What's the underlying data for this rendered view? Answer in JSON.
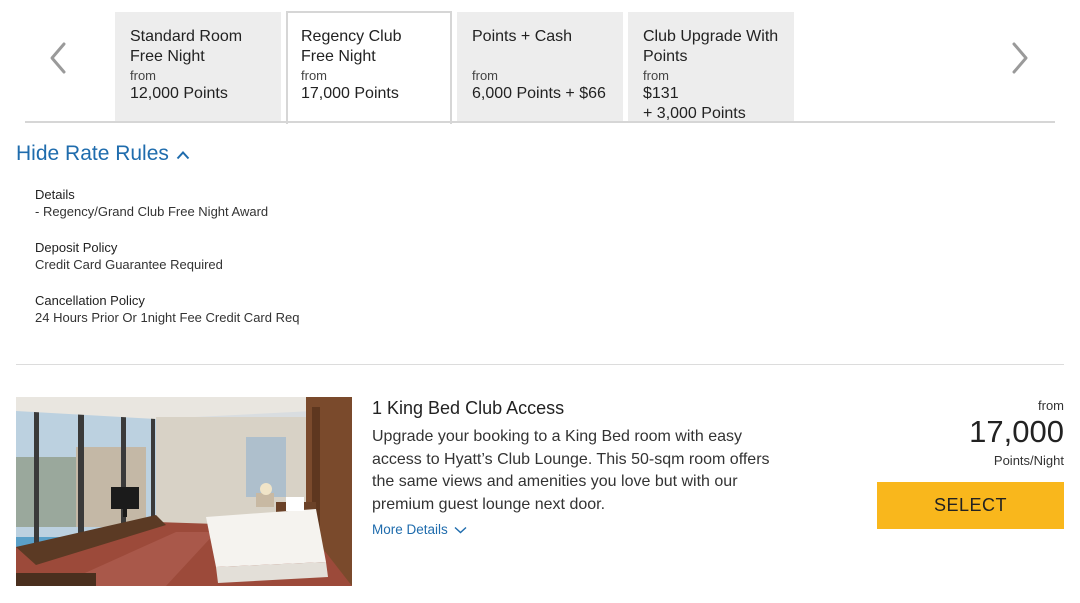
{
  "rate_tabs": [
    {
      "title": "Standard Room Free Night",
      "from": "from",
      "price": "12,000 Points"
    },
    {
      "title": "Regency Club Free Night",
      "from": "from",
      "price": "17,000 Points"
    },
    {
      "title": "Points + Cash",
      "from": "from",
      "price": "6,000 Points + $66"
    },
    {
      "title": "Club Upgrade With Points",
      "from": "from",
      "price": "$131\n+ 3,000 Points"
    }
  ],
  "active_tab_index": 1,
  "icons": {
    "prev": "chevron-left-icon",
    "next": "chevron-right-icon",
    "collapse": "chevron-up-icon",
    "expand": "chevron-down-icon"
  },
  "rate_rules": {
    "toggle_label": "Hide Rate Rules",
    "details_label": "Details",
    "details_text": "- Regency/Grand Club Free Night Award",
    "deposit_label": "Deposit Policy",
    "deposit_text": "Credit Card Guarantee Required",
    "cancellation_label": "Cancellation Policy",
    "cancellation_text": "24 Hours Prior Or 1night Fee Credit Card Req"
  },
  "room": {
    "title": "1 King Bed Club Access",
    "description": "Upgrade your booking to a King Bed room with easy access to Hyatt’s Club Lounge. This 50-sqm room offers the same views and amenities you love but with our premium guest lounge next door.",
    "more_details_label": "More Details",
    "price_from": "from",
    "price_value": "17,000",
    "price_unit": "Points/Night",
    "select_label": "SELECT"
  },
  "colors": {
    "link": "#1f6cad",
    "select_button": "#f9b71c",
    "inactive_tab": "#ededed"
  }
}
